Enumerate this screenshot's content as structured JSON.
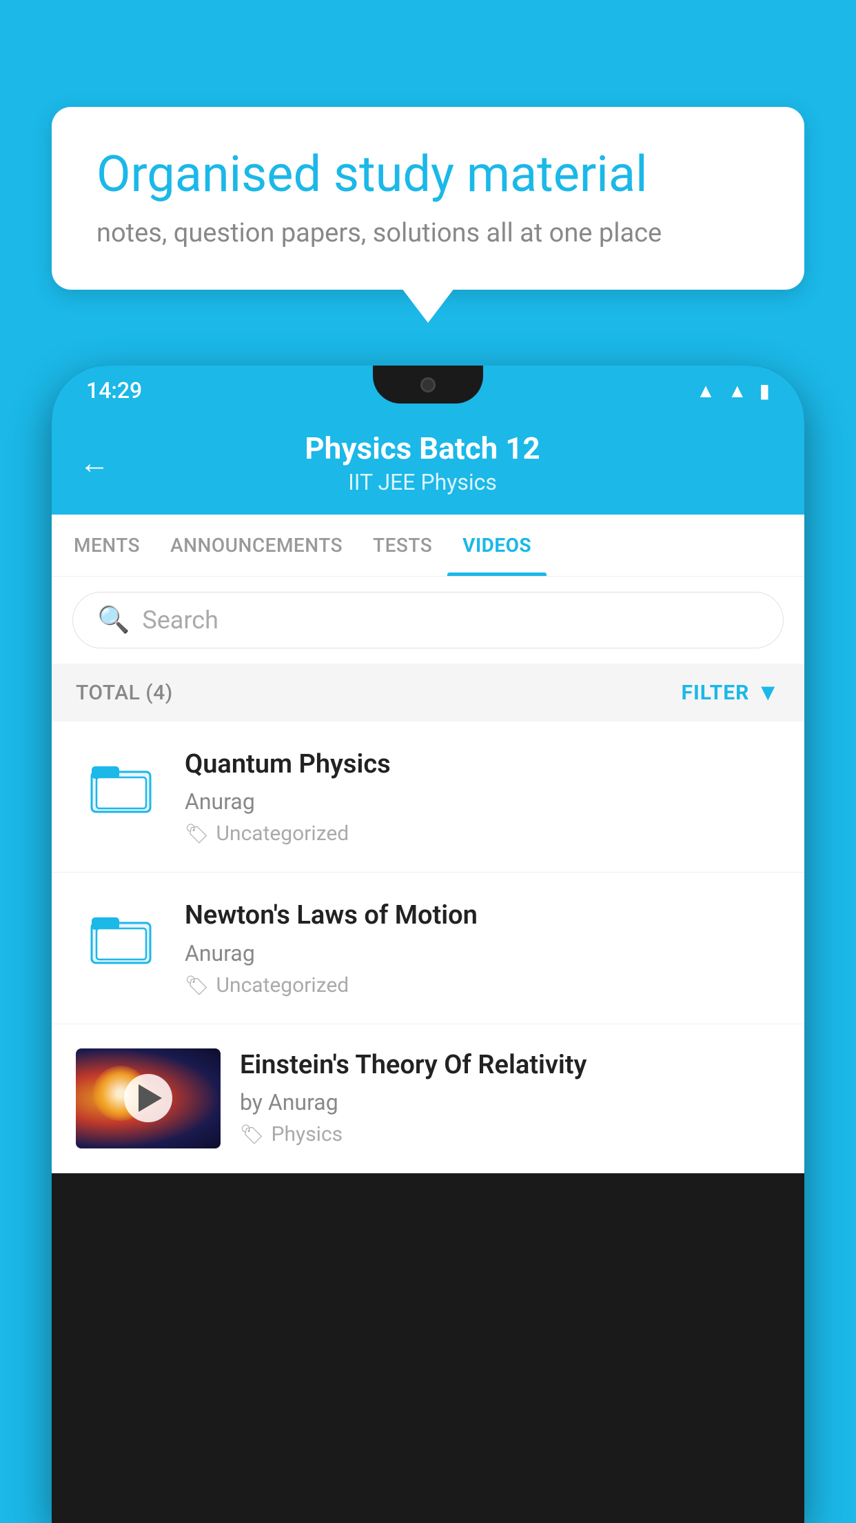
{
  "background_color": "#1BB8E8",
  "speech_bubble": {
    "title": "Organised study material",
    "subtitle": "notes, question papers, solutions all at one place"
  },
  "phone": {
    "status_bar": {
      "time": "14:29",
      "icons": [
        "wifi",
        "signal",
        "battery"
      ]
    },
    "top_bar": {
      "title": "Physics Batch 12",
      "tags": "IIT JEE    Physics",
      "back_label": "←"
    },
    "tabs": [
      {
        "label": "MENTS",
        "active": false
      },
      {
        "label": "ANNOUNCEMENTS",
        "active": false
      },
      {
        "label": "TESTS",
        "active": false
      },
      {
        "label": "VIDEOS",
        "active": true
      }
    ],
    "search": {
      "placeholder": "Search"
    },
    "filter_row": {
      "total_label": "TOTAL (4)",
      "filter_label": "FILTER"
    },
    "videos": [
      {
        "id": 1,
        "title": "Quantum Physics",
        "author": "Anurag",
        "category": "Uncategorized",
        "has_thumb": false
      },
      {
        "id": 2,
        "title": "Newton's Laws of Motion",
        "author": "Anurag",
        "category": "Uncategorized",
        "has_thumb": false
      },
      {
        "id": 3,
        "title": "Einstein's Theory Of Relativity",
        "author": "by Anurag",
        "category": "Physics",
        "has_thumb": true
      }
    ]
  }
}
